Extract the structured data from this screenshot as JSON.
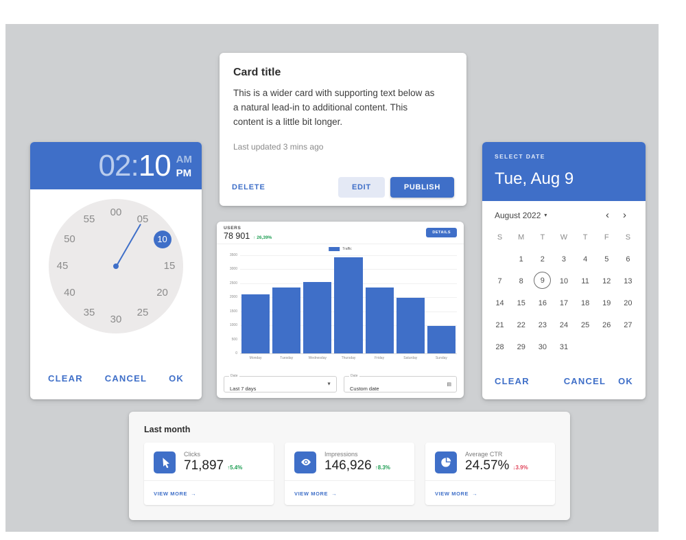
{
  "time_picker": {
    "hours": "02",
    "separator": ":",
    "minutes": "10",
    "am_label": "AM",
    "pm_label": "PM",
    "selected_minute": "10",
    "clock_numbers": [
      "00",
      "05",
      "10",
      "15",
      "20",
      "25",
      "30",
      "35",
      "40",
      "45",
      "50",
      "55"
    ],
    "actions": {
      "clear": "CLEAR",
      "cancel": "CANCEL",
      "ok": "OK"
    }
  },
  "content_card": {
    "title": "Card title",
    "body": "This is a wider card with supporting text below as a natural lead-in to additional content. This content is a little bit longer.",
    "meta": "Last updated 3 mins ago",
    "delete_label": "DELETE",
    "edit_label": "EDIT",
    "publish_label": "PUBLISH"
  },
  "chart_card": {
    "kicker": "USERS",
    "value": "78 901",
    "delta": "↑ 26,39%",
    "details_label": "DETAILS",
    "filters": [
      {
        "label": "Date",
        "value": "Last 7 days",
        "icon": "chevron-down-icon",
        "glyph": "▼"
      },
      {
        "label": "Date",
        "value": "Custom date",
        "icon": "calendar-icon",
        "glyph": "▤"
      }
    ]
  },
  "chart_data": {
    "type": "bar",
    "title": "USERS",
    "categories": [
      "Monday",
      "Tuesday",
      "Wednesday",
      "Thursday",
      "Friday",
      "Saturday",
      "Sunday"
    ],
    "series": [
      {
        "name": "Traffic",
        "values": [
          2110,
          2340,
          2540,
          3420,
          2360,
          1980,
          980
        ]
      }
    ],
    "legend": [
      "Traffic"
    ],
    "legend_position": "top-center",
    "yticks": [
      0,
      500,
      1000,
      1500,
      2000,
      2500,
      3000,
      3500
    ],
    "ytick_labels": [
      "0",
      "500",
      "1000",
      "1500",
      "2000",
      "2500",
      "3000",
      "3500"
    ],
    "ylim": [
      0,
      3500
    ],
    "xlabel": "",
    "ylabel": "",
    "grid": true,
    "bar_color": "#3f6fc8"
  },
  "date_picker": {
    "kicker": "SELECT DATE",
    "selected_date": "Tue, Aug 9",
    "month_label": "August 2022",
    "caret": "▾",
    "prev_label": "‹",
    "next_label": "›",
    "weekdays": [
      "S",
      "M",
      "T",
      "W",
      "T",
      "F",
      "S"
    ],
    "leading_blanks": 1,
    "days": [
      1,
      2,
      3,
      4,
      5,
      6,
      7,
      8,
      9,
      10,
      11,
      12,
      13,
      14,
      15,
      16,
      17,
      18,
      19,
      20,
      21,
      22,
      23,
      24,
      25,
      26,
      27,
      28,
      29,
      30,
      31
    ],
    "today": 9,
    "actions": {
      "clear": "CLEAR",
      "cancel": "CANCEL",
      "ok": "OK"
    }
  },
  "stats_panel": {
    "title": "Last month",
    "view_more_label": "VIEW MORE",
    "arrow": "→",
    "cards": [
      {
        "icon": "cursor-click-icon",
        "name": "Clicks",
        "value": "71,897",
        "delta": "↑5.4%",
        "direction": "up"
      },
      {
        "icon": "eye-icon",
        "name": "Impressions",
        "value": "146,926",
        "delta": "↑8.3%",
        "direction": "up"
      },
      {
        "icon": "pie-chart-icon",
        "name": "Average CTR",
        "value": "24.57%",
        "delta": "↓3.9%",
        "direction": "down"
      }
    ]
  },
  "colors": {
    "accent": "#3f6fc8",
    "canvas": "#ced0d2",
    "positive": "#1e9e53",
    "negative": "#e0465c"
  }
}
